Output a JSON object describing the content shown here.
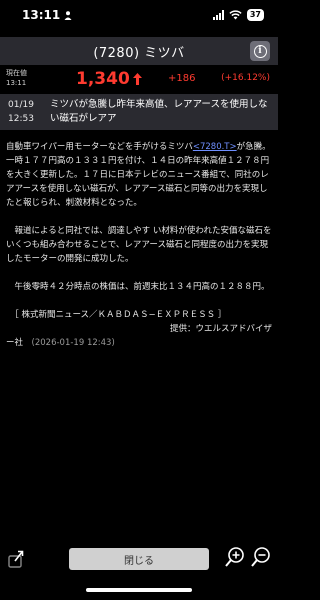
{
  "status_bar": {
    "time": "13:11",
    "battery": "37"
  },
  "header": {
    "title": "(7280) ミツバ"
  },
  "quote": {
    "label_current": "現在値",
    "label_time": "13:11",
    "price": "1,340",
    "change": "+186",
    "change_pct": "(+16.12%)",
    "color_up": "#ff3b30"
  },
  "news": {
    "date": "01/19",
    "time": "12:53",
    "title": "ミツバが急騰し昨年来高値、レアアースを使用しない磁石がレアア"
  },
  "article": {
    "p1_before": "自動車ワイパー用モーターなどを手がけるミツバ",
    "p1_link": "<7280.T>",
    "p1_after": "が急騰。一時１７７円高の１３３１円を付け、１４日の昨年来高値１２７８円を大きく更新した。１７日に日本テレビのニュース番組で、同社のレアアースを使用しない磁石が、レアアース磁石と同等の出力を実現したと報じられ、刺激材料となった。",
    "p2": "　報道によると同社では、調達しやす い材料が使われた安価な磁石をいくつも組み合わせることで、レアアース磁石と同程度の出力を実現したモーターの開発に成功した。",
    "p3": "　午後零時４２分時点の株価は、前週末比１３４円高の１２８８円。",
    "source": "　［ 株式新聞ニュース／ＫＡＢＤＡＳ−ＥＸＰＲＥＳＳ ］",
    "provider": "提供：ウエルスアドバイザ",
    "provider_cont": "ー社",
    "timestamp": "(2026-01-19 12:43)"
  },
  "bottom_bar": {
    "close_label": "閉じる"
  },
  "icons": {
    "share": "share-icon",
    "zoom_in": "zoom-in-icon",
    "zoom_out": "zoom-out-icon",
    "info": "info-icon"
  }
}
